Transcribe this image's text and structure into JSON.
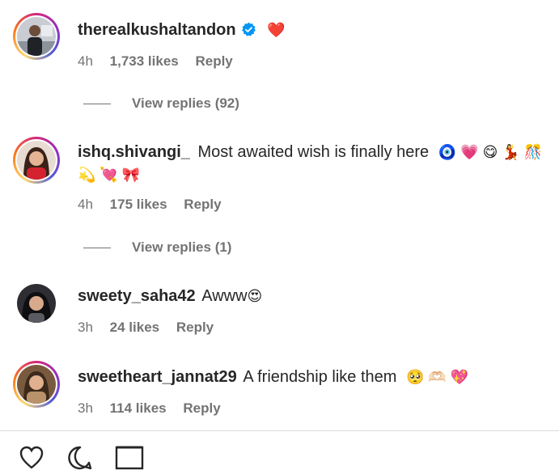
{
  "comments": [
    {
      "username": "therealkushaltandon",
      "text": "",
      "emoji": "❤️",
      "verified": true,
      "time": "4h",
      "likes": "1,733 likes",
      "reply": "Reply",
      "view_replies": "View replies (92)"
    },
    {
      "username": "ishq.shivangi_",
      "text": "Most awaited wish is finally here",
      "emoji_line1": "🧿 💗 😋 💃 🎊",
      "emoji_line2": "💫 💘 🎀",
      "time": "4h",
      "likes": "175 likes",
      "reply": "Reply",
      "view_replies": "View replies (1)"
    },
    {
      "username": "sweety_saha42",
      "text": "Awww",
      "emoji": "😍",
      "time": "3h",
      "likes": "24 likes",
      "reply": "Reply"
    },
    {
      "username": "sweetheart_jannat29",
      "text": "A friendship like them",
      "emoji": "🥺 🫶🏻 💖",
      "time": "3h",
      "likes": "114 likes",
      "reply": "Reply"
    }
  ],
  "colors": {
    "text": "#262626",
    "meta": "#737373",
    "verified": "#0095f6",
    "heart": "#ed4956"
  }
}
